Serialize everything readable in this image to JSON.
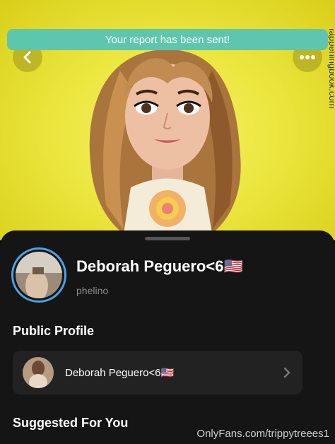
{
  "toast": {
    "message": "Your report has been sent!"
  },
  "header": {
    "back_icon": "chevron-left-icon",
    "more_icon": "more-horizontal-icon"
  },
  "watermark_side": "fappeningbook.com",
  "profile": {
    "display_name": "Deborah Peguero<6🇺🇸",
    "username": "phelino"
  },
  "public_profile": {
    "title": "Public Profile",
    "name": "Deborah Peguero<6🇺🇸"
  },
  "suggested": {
    "title": "Suggested For You"
  },
  "footer_watermark": "OnlyFans.com/trippytreees1",
  "colors": {
    "background_yellow": "#ece740",
    "toast": "#5ec6ad",
    "sheet": "#151515",
    "ring": "#4aa3e8"
  }
}
